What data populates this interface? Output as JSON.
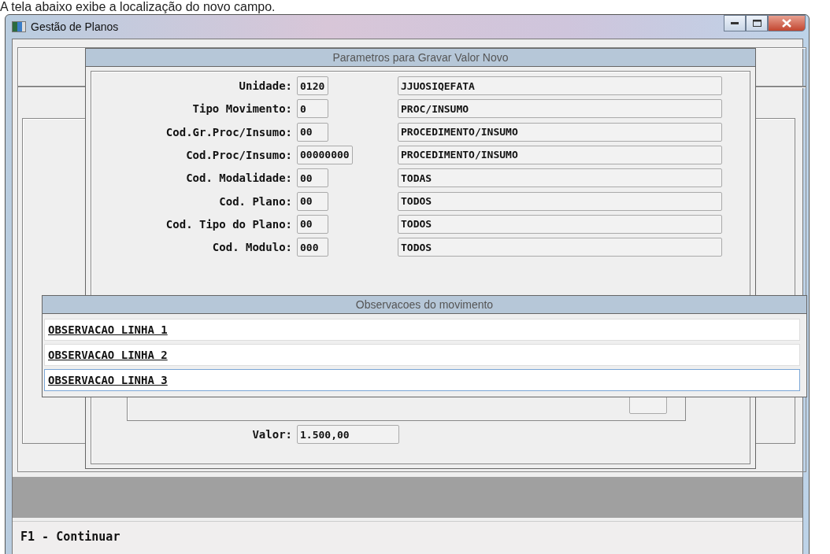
{
  "caption": "A tela abaixo exibe a localização do novo campo.",
  "window": {
    "title": "Gestão de Planos"
  },
  "params_dialog": {
    "title": "Parametros para Gravar Valor Novo",
    "rows": [
      {
        "label": "Unidade:",
        "code": "0120",
        "description": "JJUOSIQEFATA"
      },
      {
        "label": "Tipo Movimento:",
        "code": "0",
        "description": "PROC/INSUMO"
      },
      {
        "label": "Cod.Gr.Proc/Insumo:",
        "code": "00",
        "description": "PROCEDIMENTO/INSUMO"
      },
      {
        "label": "Cod.Proc/Insumo:",
        "code": "00000000",
        "description": "PROCEDIMENTO/INSUMO"
      },
      {
        "label": "Cod. Modalidade:",
        "code": "00",
        "description": "TODAS"
      },
      {
        "label": "Cod. Plano:",
        "code": "00",
        "description": "TODOS"
      },
      {
        "label": "Cod. Tipo do Plano:",
        "code": "00",
        "description": "TODOS"
      },
      {
        "label": "Cod. Modulo:",
        "code": "000",
        "description": "TODOS"
      }
    ],
    "value": {
      "label": "Valor:",
      "value": "1.500,00"
    }
  },
  "observations_dialog": {
    "title": "Observacoes do movimento",
    "lines": [
      {
        "value": "OBSERVACAO LINHA 1",
        "focused": false
      },
      {
        "value": "OBSERVACAO LINHA 2",
        "focused": false
      },
      {
        "value": "OBSERVACAO LINHA 3",
        "focused": true
      }
    ]
  },
  "status_bar": "F1 - Continuar"
}
